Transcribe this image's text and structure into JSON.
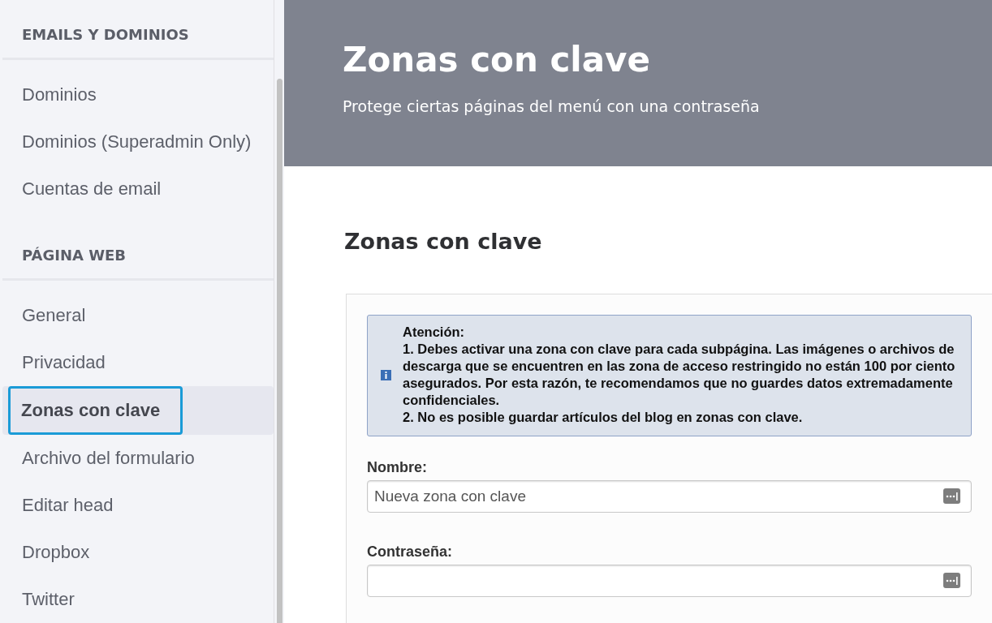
{
  "sidebar": {
    "sections": [
      {
        "heading": "EMAILS Y DOMINIOS",
        "items": [
          {
            "label": "Dominios",
            "selected": false
          },
          {
            "label": "Dominios (Superadmin Only)",
            "selected": false
          },
          {
            "label": "Cuentas de email",
            "selected": false
          }
        ]
      },
      {
        "heading": "PÁGINA WEB",
        "items": [
          {
            "label": "General",
            "selected": false
          },
          {
            "label": "Privacidad",
            "selected": false
          },
          {
            "label": "Zonas con clave",
            "selected": true
          },
          {
            "label": "Archivo del formulario",
            "selected": false
          },
          {
            "label": "Editar head",
            "selected": false
          },
          {
            "label": "Dropbox",
            "selected": false
          },
          {
            "label": "Twitter",
            "selected": false
          }
        ]
      }
    ]
  },
  "header": {
    "title": "Zonas con clave",
    "subtitle": "Protege ciertas páginas del menú con una contraseña"
  },
  "section_title": "Zonas con clave",
  "notice": {
    "title": "Atención:",
    "lines": [
      "1. Debes activar una zona con clave para cada subpágina. Las imágenes o archivos de descarga que se encuentren en las zona de acceso restringido no están 100 por ciento asegurados. Por esta razón, te recomendamos que no guardes datos extremadamente confidenciales.",
      "2. No es posible guardar artículos del blog en zonas con clave."
    ]
  },
  "fields": [
    {
      "label": "Nombre:",
      "value": "Nueva zona con clave"
    },
    {
      "label": "Contraseña:"
    }
  ]
}
